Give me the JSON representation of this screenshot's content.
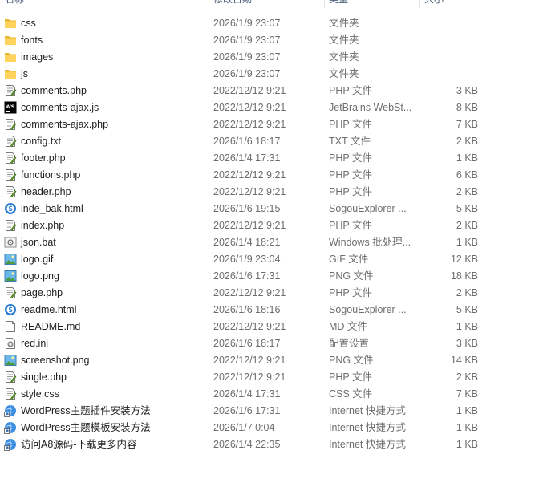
{
  "columns": {
    "name": "名称",
    "date": "修改日期",
    "type": "类型",
    "size": "大小"
  },
  "files": [
    {
      "name": "css",
      "date": "2026/1/9 23:07",
      "type": "文件夹",
      "size": "",
      "icon": "folder-icon"
    },
    {
      "name": "fonts",
      "date": "2026/1/9 23:07",
      "type": "文件夹",
      "size": "",
      "icon": "folder-icon"
    },
    {
      "name": "images",
      "date": "2026/1/9 23:07",
      "type": "文件夹",
      "size": "",
      "icon": "folder-icon"
    },
    {
      "name": "js",
      "date": "2026/1/9 23:07",
      "type": "文件夹",
      "size": "",
      "icon": "folder-icon"
    },
    {
      "name": "comments.php",
      "date": "2022/12/12 9:21",
      "type": "PHP 文件",
      "size": "3 KB",
      "icon": "php-file-icon"
    },
    {
      "name": "comments-ajax.js",
      "date": "2022/12/12 9:21",
      "type": "JetBrains WebSt...",
      "size": "8 KB",
      "icon": "webstorm-file-icon"
    },
    {
      "name": "comments-ajax.php",
      "date": "2022/12/12 9:21",
      "type": "PHP 文件",
      "size": "7 KB",
      "icon": "php-file-icon"
    },
    {
      "name": "config.txt",
      "date": "2026/1/6 18:17",
      "type": "TXT 文件",
      "size": "2 KB",
      "icon": "text-file-icon"
    },
    {
      "name": "footer.php",
      "date": "2026/1/4 17:31",
      "type": "PHP 文件",
      "size": "1 KB",
      "icon": "php-file-icon"
    },
    {
      "name": "functions.php",
      "date": "2022/12/12 9:21",
      "type": "PHP 文件",
      "size": "6 KB",
      "icon": "php-file-icon"
    },
    {
      "name": "header.php",
      "date": "2022/12/12 9:21",
      "type": "PHP 文件",
      "size": "2 KB",
      "icon": "php-file-icon"
    },
    {
      "name": "inde_bak.html",
      "date": "2026/1/6 19:15",
      "type": "SogouExplorer ...",
      "size": "5 KB",
      "icon": "sogou-html-icon"
    },
    {
      "name": "index.php",
      "date": "2022/12/12 9:21",
      "type": "PHP 文件",
      "size": "2 KB",
      "icon": "php-file-icon"
    },
    {
      "name": "json.bat",
      "date": "2026/1/4 18:21",
      "type": "Windows 批处理...",
      "size": "1 KB",
      "icon": "batch-file-icon"
    },
    {
      "name": "logo.gif",
      "date": "2026/1/9 23:04",
      "type": "GIF 文件",
      "size": "12 KB",
      "icon": "image-file-icon"
    },
    {
      "name": "logo.png",
      "date": "2026/1/6 17:31",
      "type": "PNG 文件",
      "size": "18 KB",
      "icon": "image-file-icon"
    },
    {
      "name": "page.php",
      "date": "2022/12/12 9:21",
      "type": "PHP 文件",
      "size": "2 KB",
      "icon": "php-file-icon"
    },
    {
      "name": "readme.html",
      "date": "2026/1/6 18:16",
      "type": "SogouExplorer ...",
      "size": "5 KB",
      "icon": "sogou-html-icon"
    },
    {
      "name": "README.md",
      "date": "2022/12/12 9:21",
      "type": "MD 文件",
      "size": "1 KB",
      "icon": "blank-file-icon"
    },
    {
      "name": "red.ini",
      "date": "2026/1/6 18:17",
      "type": "配置设置",
      "size": "3 KB",
      "icon": "config-file-icon"
    },
    {
      "name": "screenshot.png",
      "date": "2022/12/12 9:21",
      "type": "PNG 文件",
      "size": "14 KB",
      "icon": "image-file-icon"
    },
    {
      "name": "single.php",
      "date": "2022/12/12 9:21",
      "type": "PHP 文件",
      "size": "2 KB",
      "icon": "php-file-icon"
    },
    {
      "name": "style.css",
      "date": "2026/1/4 17:31",
      "type": "CSS 文件",
      "size": "7 KB",
      "icon": "php-file-icon"
    },
    {
      "name": "WordPress主题插件安装方法",
      "date": "2026/1/6 17:31",
      "type": "Internet 快捷方式",
      "size": "1 KB",
      "icon": "internet-shortcut-icon"
    },
    {
      "name": "WordPress主题模板安装方法",
      "date": "2026/1/7 0:04",
      "type": "Internet 快捷方式",
      "size": "1 KB",
      "icon": "internet-shortcut-icon"
    },
    {
      "name": "访问A8源码-下载更多内容",
      "date": "2026/1/4 22:35",
      "type": "Internet 快捷方式",
      "size": "1 KB",
      "icon": "internet-shortcut-icon"
    }
  ]
}
